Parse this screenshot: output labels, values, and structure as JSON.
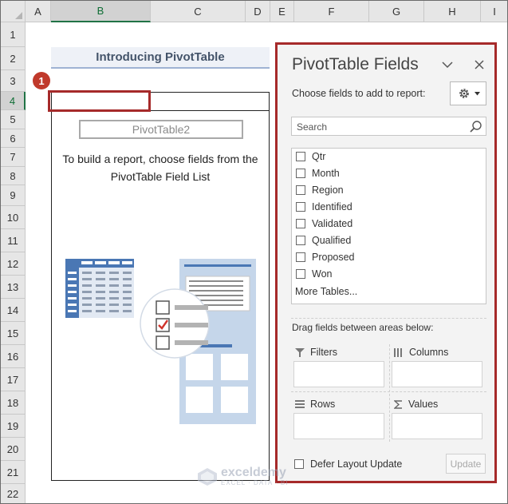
{
  "columns": [
    {
      "label": "A",
      "selected": false
    },
    {
      "label": "B",
      "selected": true
    },
    {
      "label": "C",
      "selected": false
    },
    {
      "label": "D",
      "selected": false
    },
    {
      "label": "E",
      "selected": false
    },
    {
      "label": "F",
      "selected": false
    },
    {
      "label": "G",
      "selected": false
    },
    {
      "label": "H",
      "selected": false
    },
    {
      "label": "I",
      "selected": false
    }
  ],
  "rows": [
    {
      "label": "1",
      "selected": false
    },
    {
      "label": "2",
      "selected": false
    },
    {
      "label": "3",
      "selected": false
    },
    {
      "label": "4",
      "selected": true
    },
    {
      "label": "5",
      "selected": false
    },
    {
      "label": "6",
      "selected": false
    },
    {
      "label": "7",
      "selected": false
    },
    {
      "label": "8",
      "selected": false
    },
    {
      "label": "9",
      "selected": false
    },
    {
      "label": "10",
      "selected": false
    },
    {
      "label": "11",
      "selected": false
    },
    {
      "label": "12",
      "selected": false
    },
    {
      "label": "13",
      "selected": false
    },
    {
      "label": "14",
      "selected": false
    },
    {
      "label": "15",
      "selected": false
    },
    {
      "label": "16",
      "selected": false
    },
    {
      "label": "17",
      "selected": false
    },
    {
      "label": "18",
      "selected": false
    },
    {
      "label": "19",
      "selected": false
    },
    {
      "label": "20",
      "selected": false
    },
    {
      "label": "21",
      "selected": false
    },
    {
      "label": "22",
      "selected": false
    }
  ],
  "sheet": {
    "title": "Introducing PivotTable",
    "step_badge": "1"
  },
  "pivot": {
    "name": "PivotTable2",
    "instructions": "To build a report, choose fields from the PivotTable Field List"
  },
  "field_panel": {
    "title": "PivotTable Fields",
    "choose_label": "Choose fields to add to report:",
    "search_placeholder": "Search",
    "fields": [
      {
        "label": "Qtr",
        "checked": false
      },
      {
        "label": "Month",
        "checked": false
      },
      {
        "label": "Region",
        "checked": false
      },
      {
        "label": "Identified",
        "checked": false
      },
      {
        "label": "Validated",
        "checked": false
      },
      {
        "label": "Qualified",
        "checked": false
      },
      {
        "label": "Proposed",
        "checked": false
      },
      {
        "label": "Won",
        "checked": false
      }
    ],
    "more_tables": "More Tables...",
    "drag_label": "Drag fields between areas below:",
    "areas": {
      "filters": "Filters",
      "columns": "Columns",
      "rows": "Rows",
      "values": "Values"
    },
    "defer_label": "Defer Layout Update",
    "defer_checked": false,
    "update_label": "Update"
  },
  "watermark": {
    "name": "exceldemy",
    "tagline": "EXCEL · DATA · BI"
  },
  "colors": {
    "accent_green": "#217346",
    "highlight_red": "#a62a2a",
    "badge_red": "#c0392b",
    "title_blue": "#44546a",
    "illustration_blue": "#4a77b4"
  },
  "icons": [
    "chevron-down-icon",
    "close-icon",
    "gear-icon",
    "search-icon",
    "filter-icon",
    "columns-icon",
    "rows-icon",
    "sigma-icon"
  ]
}
